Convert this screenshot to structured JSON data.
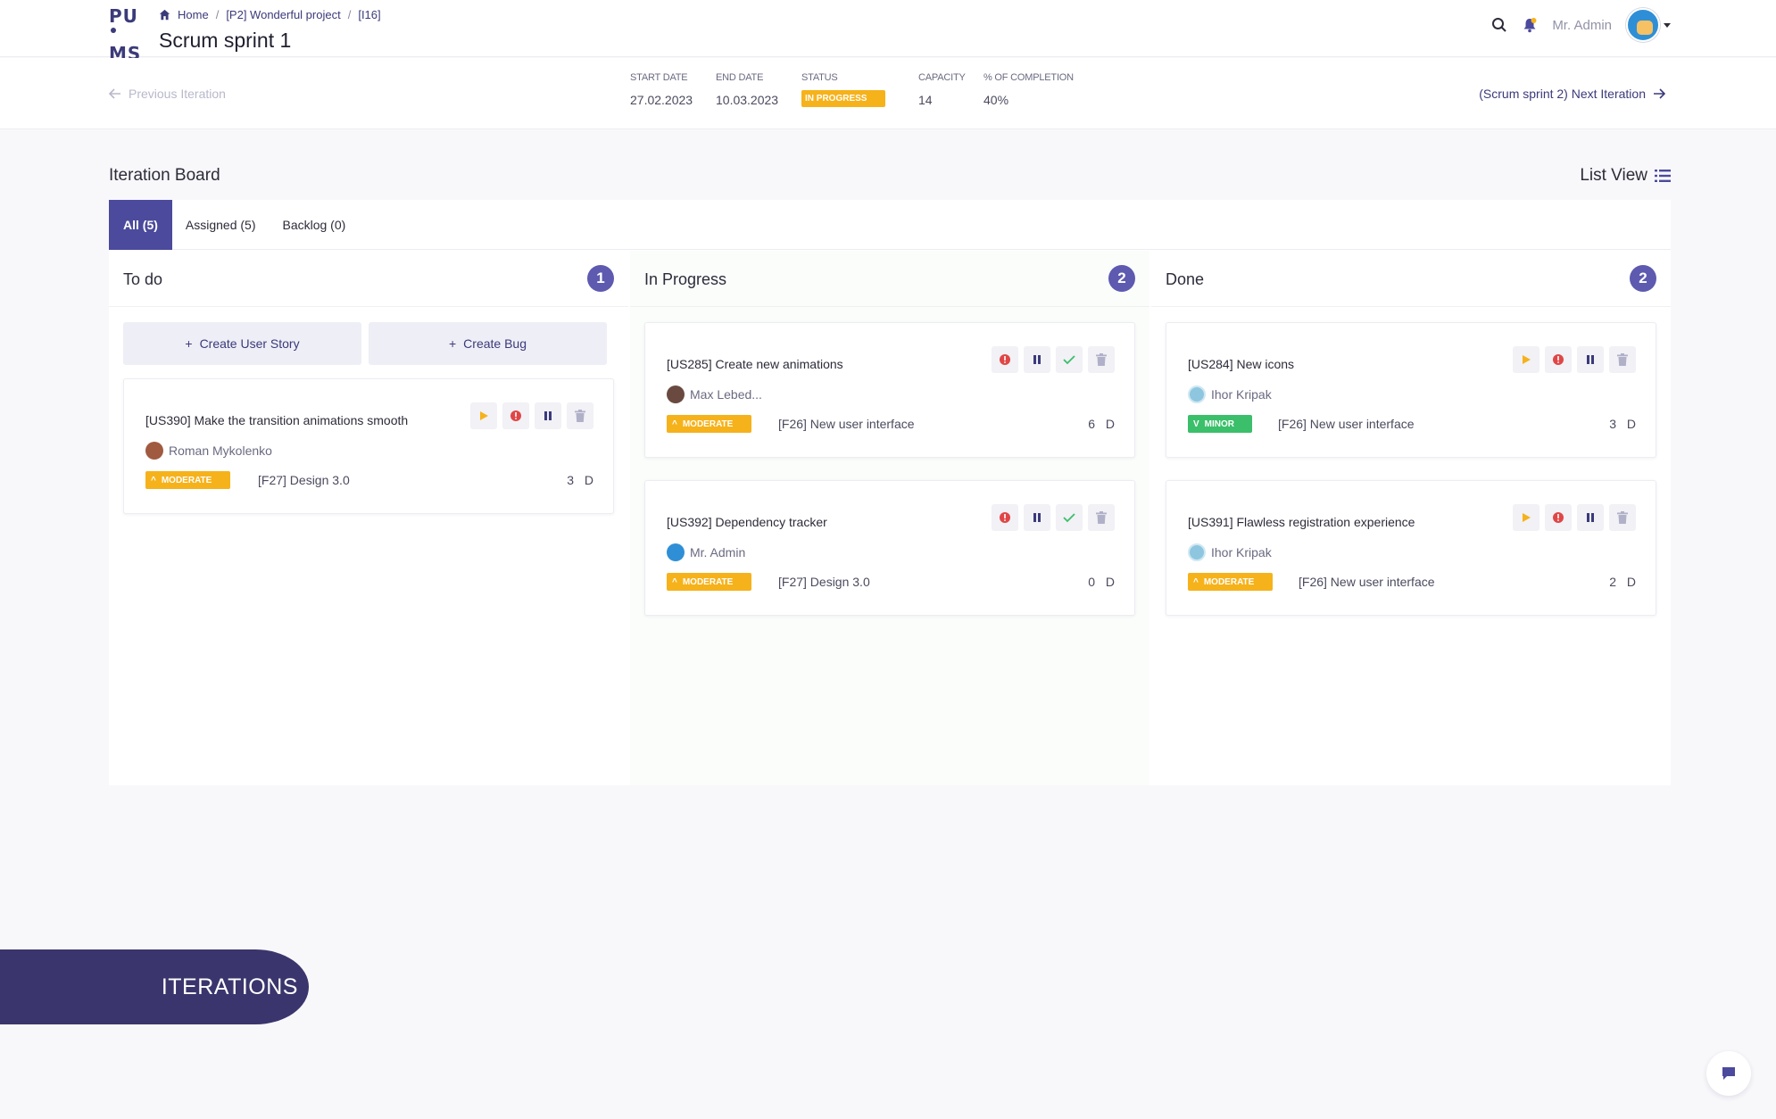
{
  "header": {
    "logo_top": "PU",
    "logo_bottom": "MS",
    "breadcrumb": [
      "Home",
      "[P2] Wonderful project",
      "[I16]"
    ],
    "title": "Scrum sprint 1",
    "user_name": "Mr. Admin"
  },
  "iteration": {
    "prev_label": "Previous Iteration",
    "next_label": "(Scrum sprint 2) Next Iteration",
    "start_label": "START DATE",
    "start_value": "27.02.2023",
    "end_label": "END DATE",
    "end_value": "10.03.2023",
    "status_label": "STATUS",
    "status_value": "IN PROGRESS",
    "capacity_label": "CAPACITY",
    "capacity_value": "14",
    "completion_label": "% OF COMPLETION",
    "completion_value": "40%"
  },
  "board": {
    "title": "Iteration Board",
    "list_view_label": "List View",
    "tabs": [
      "All (5)",
      "Assigned (5)",
      "Backlog (0)"
    ],
    "create_story": "Create User Story",
    "create_bug": "Create Bug",
    "columns": [
      {
        "title": "To do",
        "count": "1",
        "cards": [
          {
            "title": "[US390] Make the transition animations smooth",
            "assignee": "Roman Mykolenko",
            "priority": "MODERATE",
            "feature": "[F27] Design 3.0",
            "estimate": "3 D"
          }
        ]
      },
      {
        "title": "In Progress",
        "count": "2",
        "cards": [
          {
            "title": "[US285] Create new animations",
            "assignee": "Max Lebed...",
            "priority": "MODERATE",
            "feature": "[F26] New user interface",
            "estimate": "6 D"
          },
          {
            "title": "[US392] Dependency tracker",
            "assignee": "Mr. Admin",
            "priority": "MODERATE",
            "feature": "[F27] Design 3.0",
            "estimate": "0 D"
          }
        ]
      },
      {
        "title": "Done",
        "count": "2",
        "cards": [
          {
            "title": "[US284] New icons",
            "assignee": "Ihor Kripak",
            "priority": "MINOR",
            "feature": "[F26] New user interface",
            "estimate": "3 D"
          },
          {
            "title": "[US391] Flawless registration experience",
            "assignee": "Ihor Kripak",
            "priority": "MODERATE",
            "feature": "[F26] New user interface",
            "estimate": "2 D"
          }
        ]
      }
    ]
  },
  "banner": {
    "label": "ITERATIONS"
  },
  "colors": {
    "primary": "#4b4a9c",
    "badge": "#5d5ab0",
    "moderate": "#f6b21b",
    "minor": "#3bbf6a",
    "danger": "#e04646",
    "success": "#3bbf6a",
    "banner": "#3a356c"
  }
}
